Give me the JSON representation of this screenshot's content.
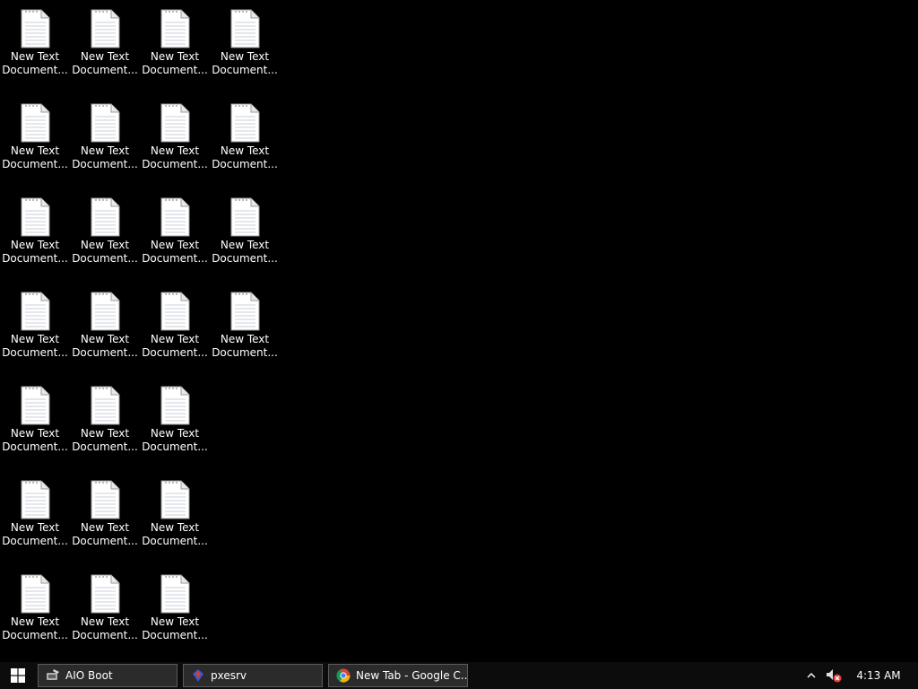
{
  "desktop": {
    "icon_label_line1": "New Text",
    "icon_label_line2": "Document...",
    "columns": [
      7,
      7,
      7,
      4
    ]
  },
  "taskbar": {
    "items": [
      {
        "label": "AIO Boot",
        "icon": "aio-boot-icon"
      },
      {
        "label": "pxesrv",
        "icon": "pxesrv-icon"
      },
      {
        "label": "New Tab - Google C...",
        "icon": "chrome-icon"
      }
    ],
    "tray": {
      "chevron_icon": "chevron-up-icon",
      "volume_icon": "volume-muted-icon",
      "clock": "4:13 AM"
    }
  }
}
